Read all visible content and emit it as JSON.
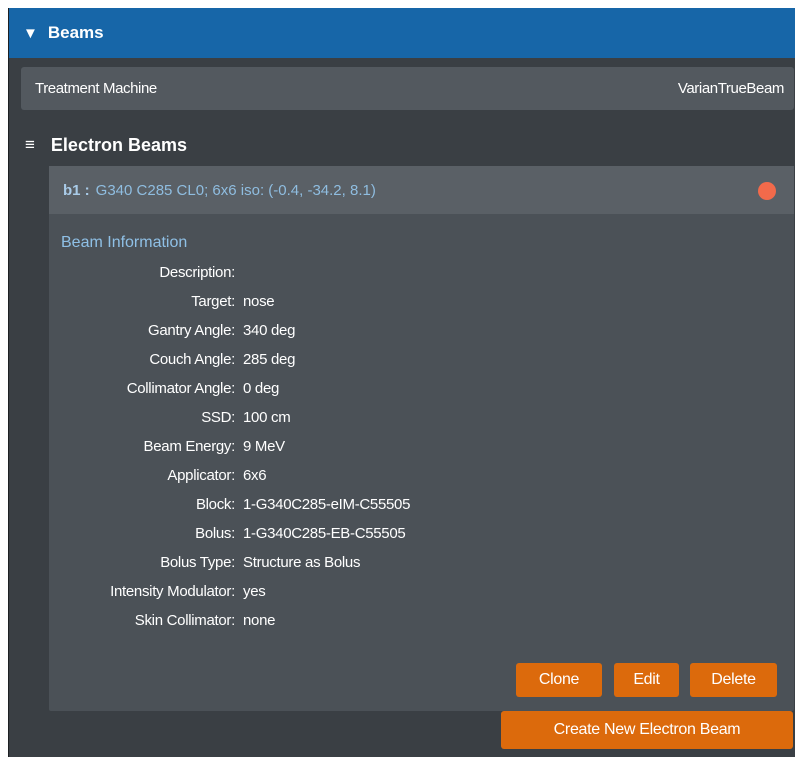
{
  "header": {
    "title": "Beams",
    "toggle_icon": "triangle-down-icon"
  },
  "machine": {
    "label": "Treatment Machine",
    "value": "VarianTrueBeam"
  },
  "section": {
    "title": "Electron Beams",
    "icon": "hamburger-icon"
  },
  "beam": {
    "id": "b1 :",
    "summary": "G340 C285 CL0; 6x6 iso: (-0.4, -34.2, 8.1)",
    "status_color": "#f26a4b",
    "info_title": "Beam Information",
    "fields": [
      {
        "label": "Description:",
        "value": ""
      },
      {
        "label": "Target:",
        "value": "nose"
      },
      {
        "label": "Gantry Angle:",
        "value": "340 deg"
      },
      {
        "label": "Couch Angle:",
        "value": "285 deg"
      },
      {
        "label": "Collimator Angle:",
        "value": "0 deg"
      },
      {
        "label": "SSD:",
        "value": "100 cm"
      },
      {
        "label": "Beam Energy:",
        "value": "9 MeV"
      },
      {
        "label": "Applicator:",
        "value": "6x6"
      },
      {
        "label": "Block:",
        "value": "1-G340C285-eIM-C55505"
      },
      {
        "label": "Bolus:",
        "value": "1-G340C285-EB-C55505"
      },
      {
        "label": "Bolus Type:",
        "value": "Structure as Bolus"
      },
      {
        "label": "Intensity Modulator:",
        "value": "yes"
      },
      {
        "label": "Skin Collimator:",
        "value": "none"
      }
    ],
    "buttons": {
      "clone": "Clone",
      "edit": "Edit",
      "delete": "Delete"
    }
  },
  "create_button": "Create New Electron Beam",
  "colors": {
    "header": "#1766a8",
    "button": "#dc6a0c",
    "panel": "#3a3f44"
  }
}
